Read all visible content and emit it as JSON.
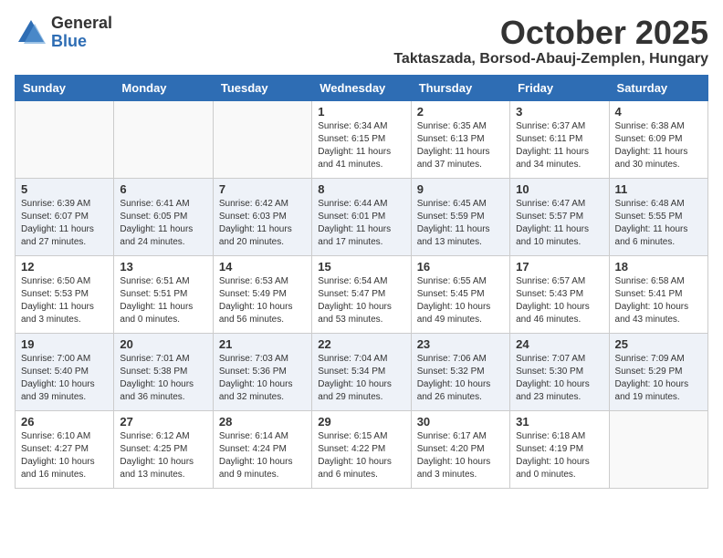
{
  "header": {
    "logo_general": "General",
    "logo_blue": "Blue",
    "month_title": "October 2025",
    "location": "Taktaszada, Borsod-Abauj-Zemplen, Hungary"
  },
  "days_of_week": [
    "Sunday",
    "Monday",
    "Tuesday",
    "Wednesday",
    "Thursday",
    "Friday",
    "Saturday"
  ],
  "weeks": [
    [
      {
        "day": "",
        "info": ""
      },
      {
        "day": "",
        "info": ""
      },
      {
        "day": "",
        "info": ""
      },
      {
        "day": "1",
        "info": "Sunrise: 6:34 AM\nSunset: 6:15 PM\nDaylight: 11 hours\nand 41 minutes."
      },
      {
        "day": "2",
        "info": "Sunrise: 6:35 AM\nSunset: 6:13 PM\nDaylight: 11 hours\nand 37 minutes."
      },
      {
        "day": "3",
        "info": "Sunrise: 6:37 AM\nSunset: 6:11 PM\nDaylight: 11 hours\nand 34 minutes."
      },
      {
        "day": "4",
        "info": "Sunrise: 6:38 AM\nSunset: 6:09 PM\nDaylight: 11 hours\nand 30 minutes."
      }
    ],
    [
      {
        "day": "5",
        "info": "Sunrise: 6:39 AM\nSunset: 6:07 PM\nDaylight: 11 hours\nand 27 minutes."
      },
      {
        "day": "6",
        "info": "Sunrise: 6:41 AM\nSunset: 6:05 PM\nDaylight: 11 hours\nand 24 minutes."
      },
      {
        "day": "7",
        "info": "Sunrise: 6:42 AM\nSunset: 6:03 PM\nDaylight: 11 hours\nand 20 minutes."
      },
      {
        "day": "8",
        "info": "Sunrise: 6:44 AM\nSunset: 6:01 PM\nDaylight: 11 hours\nand 17 minutes."
      },
      {
        "day": "9",
        "info": "Sunrise: 6:45 AM\nSunset: 5:59 PM\nDaylight: 11 hours\nand 13 minutes."
      },
      {
        "day": "10",
        "info": "Sunrise: 6:47 AM\nSunset: 5:57 PM\nDaylight: 11 hours\nand 10 minutes."
      },
      {
        "day": "11",
        "info": "Sunrise: 6:48 AM\nSunset: 5:55 PM\nDaylight: 11 hours\nand 6 minutes."
      }
    ],
    [
      {
        "day": "12",
        "info": "Sunrise: 6:50 AM\nSunset: 5:53 PM\nDaylight: 11 hours\nand 3 minutes."
      },
      {
        "day": "13",
        "info": "Sunrise: 6:51 AM\nSunset: 5:51 PM\nDaylight: 11 hours\nand 0 minutes."
      },
      {
        "day": "14",
        "info": "Sunrise: 6:53 AM\nSunset: 5:49 PM\nDaylight: 10 hours\nand 56 minutes."
      },
      {
        "day": "15",
        "info": "Sunrise: 6:54 AM\nSunset: 5:47 PM\nDaylight: 10 hours\nand 53 minutes."
      },
      {
        "day": "16",
        "info": "Sunrise: 6:55 AM\nSunset: 5:45 PM\nDaylight: 10 hours\nand 49 minutes."
      },
      {
        "day": "17",
        "info": "Sunrise: 6:57 AM\nSunset: 5:43 PM\nDaylight: 10 hours\nand 46 minutes."
      },
      {
        "day": "18",
        "info": "Sunrise: 6:58 AM\nSunset: 5:41 PM\nDaylight: 10 hours\nand 43 minutes."
      }
    ],
    [
      {
        "day": "19",
        "info": "Sunrise: 7:00 AM\nSunset: 5:40 PM\nDaylight: 10 hours\nand 39 minutes."
      },
      {
        "day": "20",
        "info": "Sunrise: 7:01 AM\nSunset: 5:38 PM\nDaylight: 10 hours\nand 36 minutes."
      },
      {
        "day": "21",
        "info": "Sunrise: 7:03 AM\nSunset: 5:36 PM\nDaylight: 10 hours\nand 32 minutes."
      },
      {
        "day": "22",
        "info": "Sunrise: 7:04 AM\nSunset: 5:34 PM\nDaylight: 10 hours\nand 29 minutes."
      },
      {
        "day": "23",
        "info": "Sunrise: 7:06 AM\nSunset: 5:32 PM\nDaylight: 10 hours\nand 26 minutes."
      },
      {
        "day": "24",
        "info": "Sunrise: 7:07 AM\nSunset: 5:30 PM\nDaylight: 10 hours\nand 23 minutes."
      },
      {
        "day": "25",
        "info": "Sunrise: 7:09 AM\nSunset: 5:29 PM\nDaylight: 10 hours\nand 19 minutes."
      }
    ],
    [
      {
        "day": "26",
        "info": "Sunrise: 6:10 AM\nSunset: 4:27 PM\nDaylight: 10 hours\nand 16 minutes."
      },
      {
        "day": "27",
        "info": "Sunrise: 6:12 AM\nSunset: 4:25 PM\nDaylight: 10 hours\nand 13 minutes."
      },
      {
        "day": "28",
        "info": "Sunrise: 6:14 AM\nSunset: 4:24 PM\nDaylight: 10 hours\nand 9 minutes."
      },
      {
        "day": "29",
        "info": "Sunrise: 6:15 AM\nSunset: 4:22 PM\nDaylight: 10 hours\nand 6 minutes."
      },
      {
        "day": "30",
        "info": "Sunrise: 6:17 AM\nSunset: 4:20 PM\nDaylight: 10 hours\nand 3 minutes."
      },
      {
        "day": "31",
        "info": "Sunrise: 6:18 AM\nSunset: 4:19 PM\nDaylight: 10 hours\nand 0 minutes."
      },
      {
        "day": "",
        "info": ""
      }
    ]
  ]
}
